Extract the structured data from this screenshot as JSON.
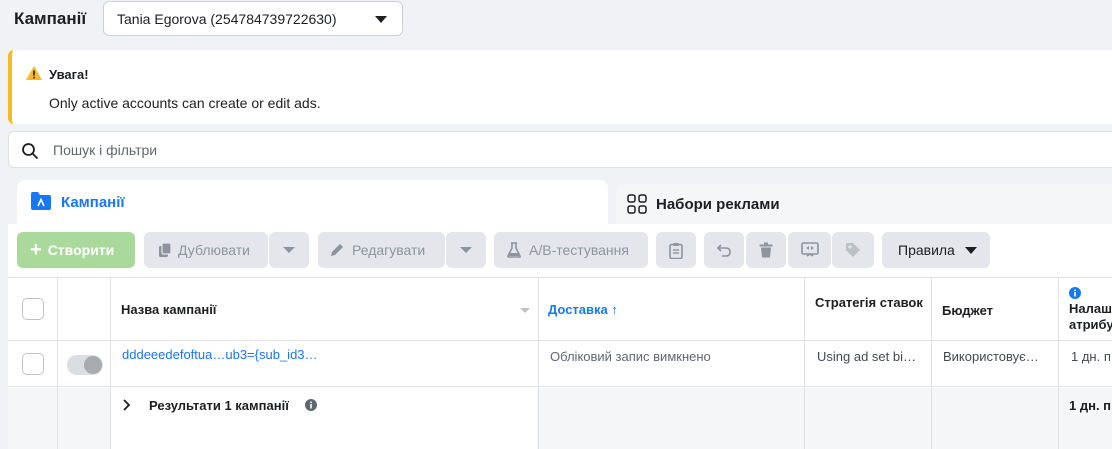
{
  "header": {
    "title": "Кампанії",
    "account": "Tania Egorova (254784739722630)"
  },
  "alert": {
    "title": "Увага!",
    "message": "Only active accounts can create or edit ads."
  },
  "search": {
    "placeholder": "Пошук і фільтри"
  },
  "tabs": [
    {
      "label": "Кампанії",
      "active": true
    },
    {
      "label": "Набори реклами",
      "active": false
    }
  ],
  "toolbar": {
    "create": "Створити",
    "duplicate": "Дублювати",
    "edit": "Редагувати",
    "ab_test": "A/B-тестування",
    "rules": "Правила"
  },
  "table": {
    "columns": {
      "name": "Назва кампанії",
      "delivery": "Доставка",
      "bid_strategy": "Стратегія ставок",
      "budget": "Бюджет",
      "attribution": "Налаш атрибу"
    },
    "rows": [
      {
        "name": "dddeeedefoftua…ub3={sub_id3…",
        "delivery": "Обліковий запис вимкнено",
        "bid_strategy": "Using ad set bi…",
        "budget": "Використовує…",
        "attribution": "1 дн. п"
      }
    ],
    "summary": {
      "label": "Результати 1 кампанії",
      "attribution": "1 дн. п"
    }
  },
  "colors": {
    "accent": "#1877f2",
    "warning": "#f7b928",
    "create_button": "#a9d99b"
  }
}
